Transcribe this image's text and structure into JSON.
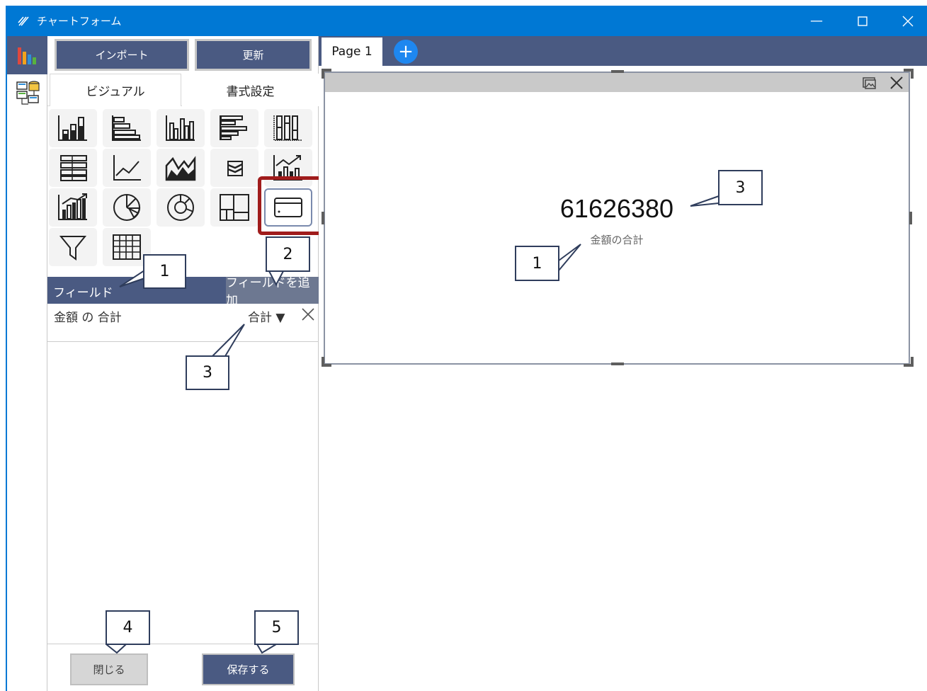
{
  "window": {
    "title": "チャートフォーム",
    "minimize_symbol": "—",
    "maximize_symbol": "☐",
    "close_symbol": "✕"
  },
  "toolbar": {
    "import_label": "インポート",
    "refresh_label": "更新"
  },
  "tabs": {
    "visual": "ビジュアル",
    "format": "書式設定"
  },
  "visual_types": [
    "stacked-column-icon",
    "stacked-bar-icon",
    "clustered-column-icon",
    "clustered-bar-icon",
    "100-column-icon",
    "100-bar-icon",
    "line-chart-icon",
    "area-chart-icon",
    "ribbon-chart-icon",
    "line-column-combo-icon",
    "waterfall-icon",
    "pie-chart-icon",
    "donut-chart-icon",
    "treemap-icon",
    "card-icon",
    "funnel-icon",
    "table-icon"
  ],
  "fields": {
    "title": "フィールド",
    "add_label": "フィールドを追加",
    "items": [
      {
        "name": "金額 の 合計",
        "aggregation": "合計 ▼"
      }
    ]
  },
  "buttons": {
    "close": "閉じる",
    "save": "保存する"
  },
  "pages": {
    "tabs": [
      "Page 1"
    ],
    "add_symbol": "+"
  },
  "card": {
    "value": "61626380",
    "label": "金額の合計"
  },
  "callouts": [
    "1",
    "2",
    "3",
    "4",
    "5",
    "1",
    "3"
  ],
  "colors": {
    "titlebar": "#0078d4",
    "panel_header": "#4a5a82",
    "highlight": "#a01c1c",
    "add_page": "#1e87f0"
  }
}
